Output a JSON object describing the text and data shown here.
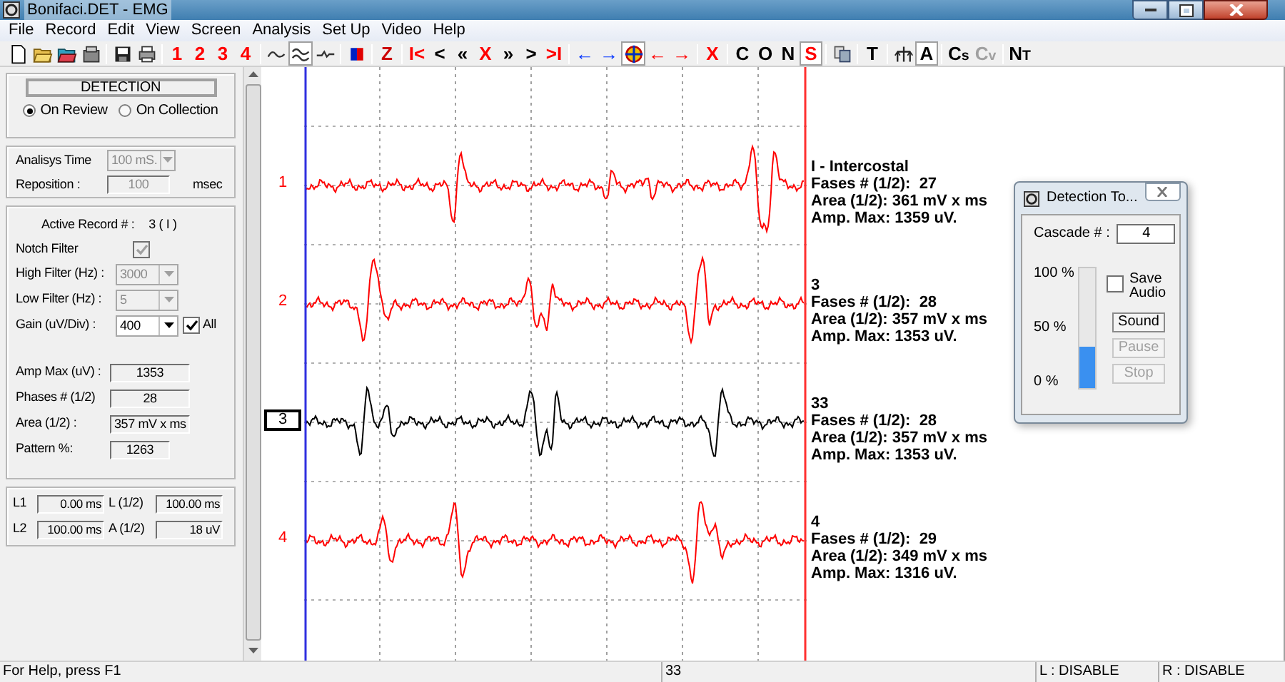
{
  "window": {
    "title": "Bonifaci.DET - EMG"
  },
  "menu": [
    "File",
    "Record",
    "Edit",
    "View",
    "Screen",
    "Analysis",
    "Set Up",
    "Video",
    "Help"
  ],
  "toolbar": [
    {
      "kind": "icon",
      "pressed": false
    },
    {
      "kind": "icon",
      "pressed": false
    },
    {
      "kind": "icon",
      "pressed": false
    },
    {
      "kind": "icon",
      "pressed": false
    },
    {
      "kind": "separator"
    },
    {
      "kind": "icon",
      "pressed": false
    },
    {
      "kind": "icon",
      "pressed": false
    },
    {
      "kind": "separator"
    },
    {
      "kind": "text",
      "text": "1",
      "color": "#ff0000",
      "pressed": false
    },
    {
      "kind": "text",
      "text": "2",
      "color": "#ff0000",
      "pressed": false
    },
    {
      "kind": "text",
      "text": "3",
      "color": "#ff0000",
      "pressed": false
    },
    {
      "kind": "text",
      "text": "4",
      "color": "#ff0000",
      "pressed": false
    },
    {
      "kind": "separator"
    },
    {
      "kind": "icon",
      "pressed": false
    },
    {
      "kind": "icon",
      "pressed": true
    },
    {
      "kind": "icon",
      "pressed": false
    },
    {
      "kind": "separator"
    },
    {
      "kind": "icon",
      "pressed": false
    },
    {
      "kind": "separator"
    },
    {
      "kind": "text",
      "text": "Z",
      "color": "#cc0000",
      "pressed": false
    },
    {
      "kind": "separator"
    },
    {
      "kind": "text",
      "text": "I<",
      "color": "#ff0000",
      "pressed": false
    },
    {
      "kind": "text",
      "text": "<",
      "color": "#000000",
      "pressed": false
    },
    {
      "kind": "text",
      "text": "«",
      "color": "#000000",
      "pressed": false
    },
    {
      "kind": "text",
      "text": "X",
      "color": "#ff0000",
      "pressed": false
    },
    {
      "kind": "text",
      "text": "»",
      "color": "#000000",
      "pressed": false
    },
    {
      "kind": "text",
      "text": ">",
      "color": "#000000",
      "pressed": false
    },
    {
      "kind": "text",
      "text": ">I",
      "color": "#ff0000",
      "pressed": false
    },
    {
      "kind": "separator"
    },
    {
      "kind": "text",
      "text": "←",
      "color": "#0033ff",
      "pressed": false
    },
    {
      "kind": "text",
      "text": "→",
      "color": "#0033ff",
      "pressed": false
    },
    {
      "kind": "icon",
      "pressed": true
    },
    {
      "kind": "text",
      "text": "←",
      "color": "#ff0000",
      "pressed": false
    },
    {
      "kind": "text",
      "text": "→",
      "color": "#ff0000",
      "pressed": false
    },
    {
      "kind": "separator"
    },
    {
      "kind": "text",
      "text": "X",
      "color": "#ff0000",
      "pressed": false
    },
    {
      "kind": "separator"
    },
    {
      "kind": "text",
      "text": "C",
      "color": "#000000",
      "pressed": false
    },
    {
      "kind": "text",
      "text": "O",
      "color": "#000000",
      "pressed": false
    },
    {
      "kind": "text",
      "text": "N",
      "color": "#000000",
      "pressed": false
    },
    {
      "kind": "text",
      "text": "S",
      "color": "#ff0000",
      "pressed": true
    },
    {
      "kind": "separator"
    },
    {
      "kind": "icon",
      "pressed": false
    },
    {
      "kind": "separator"
    },
    {
      "kind": "text",
      "text": "T",
      "color": "#000000",
      "pressed": false
    },
    {
      "kind": "separator"
    },
    {
      "kind": "icon",
      "pressed": false
    },
    {
      "kind": "text",
      "text": "A",
      "color": "#000000",
      "pressed": true
    },
    {
      "kind": "separator"
    },
    {
      "kind": "text",
      "text": "C$_{s}$",
      "color": "#000000",
      "pressed": false
    },
    {
      "kind": "text",
      "text": "C$_{v}$",
      "color": "#a0a0a0",
      "pressed": false
    },
    {
      "kind": "separator"
    },
    {
      "kind": "text",
      "text": "N$_{T}$",
      "color": "#000000",
      "pressed": false
    }
  ],
  "detection": {
    "button": "DETECTION",
    "modes": [
      {
        "label": "On Review",
        "selected": true
      },
      {
        "label": "On Collection",
        "selected": false
      }
    ]
  },
  "timing": {
    "analysis_label": "Analisys Time",
    "analysis_value": "100 mS.",
    "analysis_disabled": true,
    "reposition_label": "Reposition :",
    "reposition_value": "100",
    "reposition_unit": "msec"
  },
  "record": {
    "active_label": "Active Record # :",
    "active_value": "3 ( I )",
    "notch": {
      "label": "Notch Filter",
      "checked": true,
      "disabled": true
    },
    "filters": [
      {
        "label": "High Filter (Hz) :",
        "value": "3000",
        "disabled": true
      },
      {
        "label": "Low Filter (Hz) :",
        "value": "5",
        "disabled": true
      },
      {
        "label": "Gain (uV/Div) :",
        "value": "400",
        "disabled": false
      }
    ],
    "all": {
      "label": "All",
      "checked": true
    },
    "measures": [
      {
        "label": "Amp Max (uV) :",
        "value": "1353"
      },
      {
        "label": "Phases # (1/2)",
        "value": "28"
      },
      {
        "label": "Area (1/2) :",
        "value": "357 mV x ms"
      },
      {
        "label": "Pattern %:",
        "value": "1263"
      }
    ]
  },
  "markers": [
    {
      "label": "L1",
      "value": "0.00 ms"
    },
    {
      "label": "L (1/2)",
      "value": "100.00 ms"
    },
    {
      "label": "L2",
      "value": "100.00 ms"
    },
    {
      "label": "A (1/2)",
      "value": "18 uV"
    }
  ],
  "channels": [
    {
      "label": "1",
      "selected": false,
      "title": "I - Intercostal",
      "phases": "Fases # (1/2):  27",
      "area": "Area (1/2): 361 mV x ms",
      "amp": "Amp. Max: 1359 uV."
    },
    {
      "label": "2",
      "selected": false,
      "title": "3",
      "phases": "Fases # (1/2):  28",
      "area": "Area (1/2): 357 mV x ms",
      "amp": "Amp. Max: 1353 uV."
    },
    {
      "label": "3",
      "selected": true,
      "title": "33",
      "phases": "Fases # (1/2):  28",
      "area": "Area (1/2): 357 mV x ms",
      "amp": "Amp. Max: 1353 uV."
    },
    {
      "label": "4",
      "selected": false,
      "title": "4",
      "phases": "Fases # (1/2):  29",
      "area": "Area (1/2): 349 mV x ms",
      "amp": "Amp. Max: 1316 uV."
    }
  ],
  "dialog": {
    "title": "Detection To...",
    "cascade_label": "Cascade # :",
    "cascade_value": "4",
    "ticks": [
      "100 %",
      "50 %",
      "0 %"
    ],
    "level": 0.34,
    "save_audio": {
      "label": "Save Audio",
      "checked": false
    },
    "buttons": [
      {
        "label": "Sound",
        "disabled": false
      },
      {
        "label": "Pause",
        "disabled": true
      },
      {
        "label": "Stop",
        "disabled": true
      }
    ]
  },
  "status_bar": [
    "For Help, press F1",
    "33",
    "L : DISABLE",
    "R : DISABLE"
  ]
}
